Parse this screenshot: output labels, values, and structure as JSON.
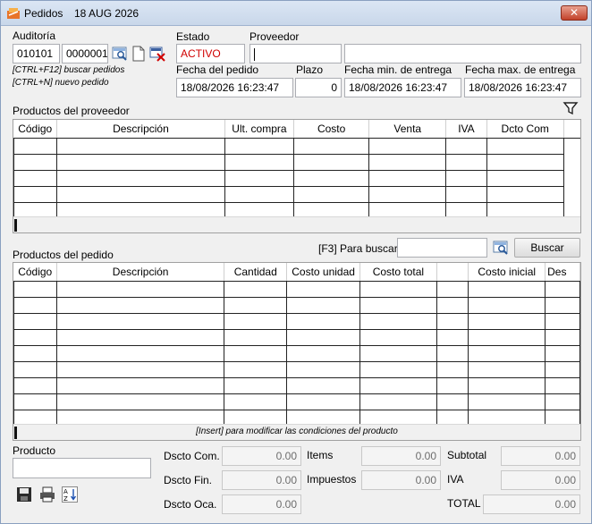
{
  "window": {
    "title": "Pedidos",
    "date": "18 AUG 2026",
    "close_label": "✕"
  },
  "auditoria": {
    "label": "Auditoría",
    "code1": "010101",
    "code2": "0000001",
    "hint1": "[CTRL+F12] buscar pedidos",
    "hint2": "[CTRL+N] nuevo pedido"
  },
  "estado": {
    "label": "Estado",
    "value": "ACTIVO",
    "color": "#d00000"
  },
  "proveedor": {
    "label": "Proveedor",
    "code": "",
    "name": ""
  },
  "fechas": {
    "pedido_label": "Fecha del pedido",
    "pedido_value": "18/08/2026 16:23:47",
    "plazo_label": "Plazo",
    "plazo_value": "0",
    "min_label": "Fecha min. de entrega",
    "min_value": "18/08/2026 16:23:47",
    "max_label": "Fecha max. de entrega",
    "max_value": "18/08/2026 16:23:47"
  },
  "proveedor_grid": {
    "title": "Productos del proveedor",
    "columns": [
      "Código",
      "Descripción",
      "Ult. compra",
      "Costo",
      "Venta",
      "IVA",
      "Dcto Com"
    ]
  },
  "pedido_grid": {
    "title": "Productos del pedido",
    "search_label": "[F3] Para buscar",
    "search_value": "",
    "search_button": "Buscar",
    "columns": [
      "Código",
      "Descripción",
      "Cantidad",
      "Costo unidad",
      "Costo total",
      "",
      "Costo inicial",
      "Des"
    ],
    "footer": "[Insert] para modificar las condiciones del producto"
  },
  "producto": {
    "label": "Producto",
    "value": ""
  },
  "totals": {
    "dscto_com_label": "Dscto Com.",
    "dscto_com": "0.00",
    "dscto_fin_label": "Dscto Fin.",
    "dscto_fin": "0.00",
    "dscto_oca_label": "Dscto Oca.",
    "dscto_oca": "0.00",
    "items_label": "Items",
    "items": "0.00",
    "impuestos_label": "Impuestos",
    "impuestos": "0.00",
    "subtotal_label": "Subtotal",
    "subtotal": "0.00",
    "iva_label": "IVA",
    "iva": "0.00",
    "total_label": "TOTAL",
    "total": "0.00"
  }
}
